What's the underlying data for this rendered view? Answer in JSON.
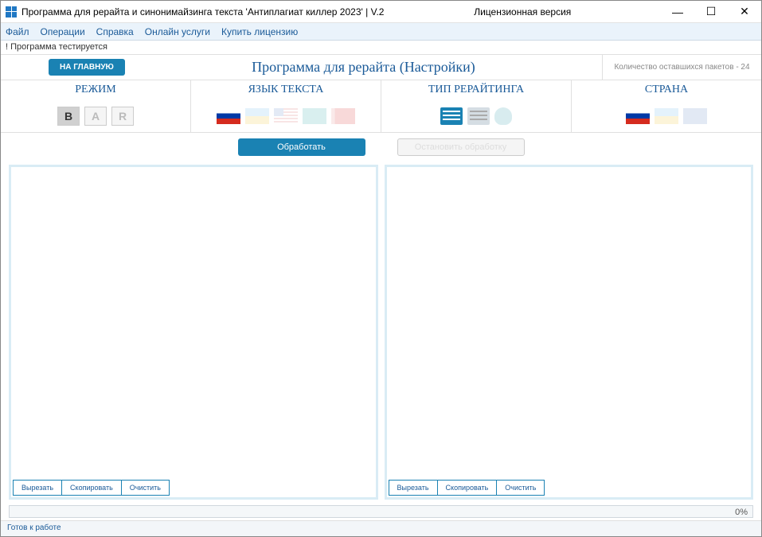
{
  "titlebar": {
    "app_title": "Программа для рерайта и синонимайзинга текста 'Антиплагиат киллер 2023' | V.2",
    "license": "Лицензионная версия"
  },
  "menubar": {
    "file": "Файл",
    "operations": "Операции",
    "help": "Справка",
    "online": "Онлайн услуги",
    "buy": "Купить лицензию"
  },
  "status_top": "! Программа тестируется",
  "toolbar": {
    "home_btn": "НА ГЛАВНУЮ",
    "page_title": "Программа для рерайта (Настройки)",
    "packets_label": "Количество оставшихся пакетов - 24"
  },
  "options": {
    "mode": {
      "header": "РЕЖИМ",
      "b": "В",
      "a": "А",
      "r": "R"
    },
    "lang": {
      "header": "ЯЗЫК ТЕКСТА"
    },
    "type": {
      "header": "ТИП РЕРАЙТИНГА"
    },
    "country": {
      "header": "СТРАНА"
    }
  },
  "actions": {
    "process": "Обработать",
    "stop": "Остановить обработку"
  },
  "panel": {
    "cut": "Вырезать",
    "copy": "Скопировать",
    "clear": "Очистить"
  },
  "progress": {
    "text": "0%"
  },
  "statusbar": {
    "ready": "Готов к работе"
  }
}
